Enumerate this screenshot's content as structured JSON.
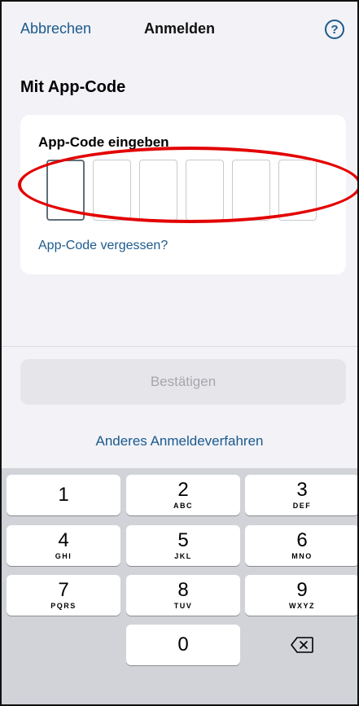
{
  "nav": {
    "cancel_label": "Abbrechen",
    "title": "Anmelden",
    "help_glyph": "?"
  },
  "section_title": "Mit App-Code",
  "code_card": {
    "label": "App-Code eingeben",
    "digit_count": 6,
    "forgot_link": "App-Code vergessen?"
  },
  "confirm_button": "Bestätigen",
  "other_method_link": "Anderes Anmeldeverfahren",
  "keypad": {
    "keys": [
      {
        "digit": "1",
        "letters": ""
      },
      {
        "digit": "2",
        "letters": "ABC"
      },
      {
        "digit": "3",
        "letters": "DEF"
      },
      {
        "digit": "4",
        "letters": "GHI"
      },
      {
        "digit": "5",
        "letters": "JKL"
      },
      {
        "digit": "6",
        "letters": "MNO"
      },
      {
        "digit": "7",
        "letters": "PQRS"
      },
      {
        "digit": "8",
        "letters": "TUV"
      },
      {
        "digit": "9",
        "letters": "WXYZ"
      },
      {
        "digit": "0",
        "letters": ""
      }
    ],
    "delete_icon": "backspace-icon"
  },
  "colors": {
    "link": "#1c5a8c",
    "annotation": "#e30000"
  }
}
